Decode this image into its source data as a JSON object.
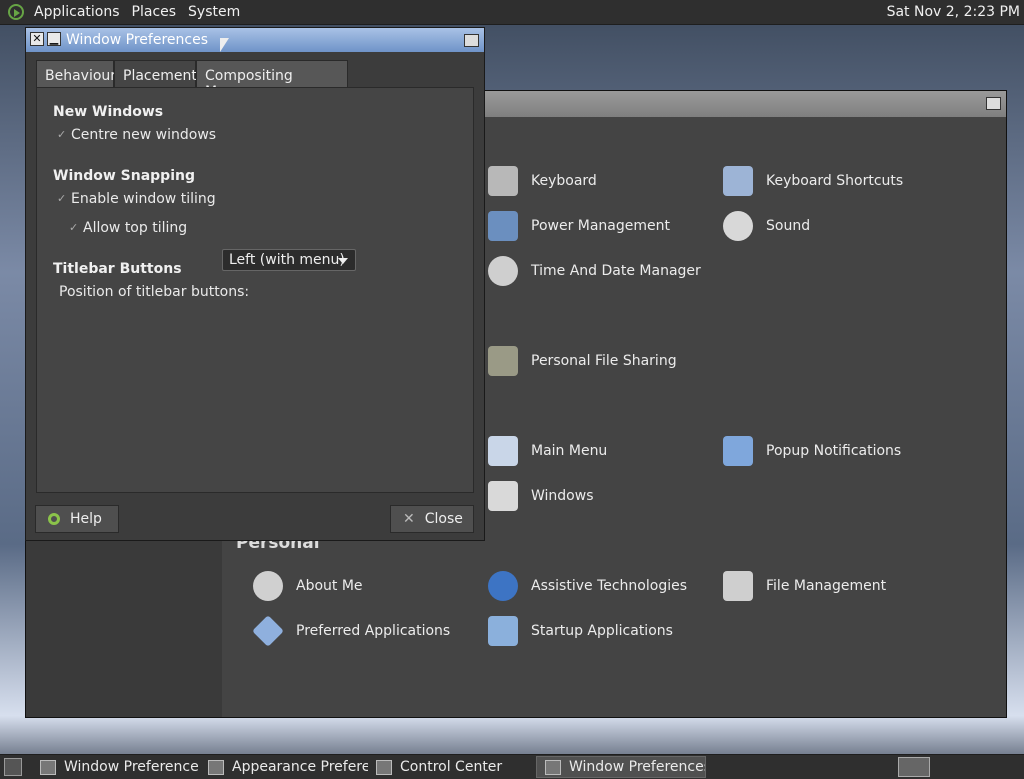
{
  "top_panel": {
    "menus": [
      "Applications",
      "Places",
      "System"
    ],
    "clock": "Sat Nov  2,  2:23 PM"
  },
  "dialog": {
    "title": "Window Preferences",
    "tabs": [
      "Behaviour",
      "Placement",
      "Compositing Manager"
    ],
    "selected_tab": "Placement",
    "new_windows": {
      "heading": "New Windows",
      "centre": "Centre new windows"
    },
    "snapping": {
      "heading": "Window Snapping",
      "tiling": "Enable window tiling",
      "top": "Allow top tiling"
    },
    "titlebar": {
      "heading": "Titlebar Buttons",
      "position_label": "Position of titlebar buttons:",
      "position_value": "Left (with menu)"
    },
    "help": "Help",
    "close": "Close"
  },
  "control_center": {
    "items": [
      {
        "label": "Keyboard",
        "icon": "keyboard-icon",
        "color": "#b8b8b8"
      },
      {
        "label": "Keyboard Shortcuts",
        "icon": "keyboard-shortcuts-icon",
        "color": "#9db4d6"
      },
      {
        "label": "Power Management",
        "icon": "power-management-icon",
        "color": "#6b8fbf"
      },
      {
        "label": "Sound",
        "icon": "sound-icon",
        "color": "#d8d8d8"
      },
      {
        "label": "Time And Date Manager",
        "icon": "clock-icon",
        "color": "#cfcfcf"
      },
      {
        "label": "Personal File Sharing",
        "icon": "folder-icon",
        "color": "#9a9a86"
      },
      {
        "label": "Main Menu",
        "icon": "main-menu-icon",
        "color": "#c9d6e8"
      },
      {
        "label": "Popup Notifications",
        "icon": "notifications-icon",
        "color": "#7fa7dc"
      },
      {
        "label": "Windows",
        "icon": "windows-icon",
        "color": "#d9d9d9"
      },
      {
        "label": "About Me",
        "icon": "about-me-icon",
        "color": "#d0d0d0"
      },
      {
        "label": "Assistive Technologies",
        "icon": "accessibility-icon",
        "color": "#3d74c4"
      },
      {
        "label": "File Management",
        "icon": "file-management-icon",
        "color": "#cfcfcf"
      },
      {
        "label": "Preferred Applications",
        "icon": "preferred-apps-icon",
        "color": "#8fb0de"
      },
      {
        "label": "Startup Applications",
        "icon": "startup-apps-icon",
        "color": "#8bb0dc"
      }
    ],
    "section": "Personal"
  },
  "taskbar": [
    {
      "label": "Window Preferences",
      "active": false
    },
    {
      "label": "Appearance Prefere...",
      "active": false
    },
    {
      "label": "Control Center",
      "active": false
    },
    {
      "label": "Window Preferences",
      "active": true
    }
  ]
}
